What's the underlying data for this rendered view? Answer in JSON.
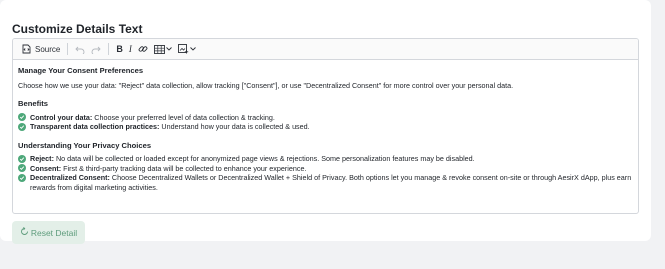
{
  "section": {
    "title": "Customize Details Text"
  },
  "toolbar": {
    "source_label": "Source"
  },
  "content": {
    "heading": "Manage Your Consent Preferences",
    "intro": "Choose how we use your data: \"Reject\" data collection, allow tracking [\"Consent\"], or use \"Decentralized Consent\" for more control over your personal data.",
    "benefits_heading": "Benefits",
    "benefits": [
      {
        "bold": "Control your data:",
        "text": " Choose your preferred level of data collection & tracking."
      },
      {
        "bold": "Transparent data collection practices:",
        "text": " Understand how your data is collected & used."
      }
    ],
    "privacy_heading": "Understanding Your Privacy Choices",
    "choices": [
      {
        "bold": "Reject:",
        "text": " No data will be collected or loaded except for anonymized page views & rejections. Some personalization features may be disabled."
      },
      {
        "bold": "Consent:",
        "text": " First & third-party tracking data will be collected to enhance your experience."
      },
      {
        "bold": "Decentralized Consent:",
        "text": " Choose Decentralized Wallets or Decentralized Wallet + Shield of Privacy. Both options let you manage & revoke consent on-site or through AesirX dApp, plus earn rewards from digital marketing activities."
      }
    ]
  },
  "reset": {
    "label": "Reset Detail"
  },
  "colors": {
    "accent": "#4ea87a",
    "reset_bg": "#e3efe8",
    "reset_text": "#5e9c7c"
  }
}
